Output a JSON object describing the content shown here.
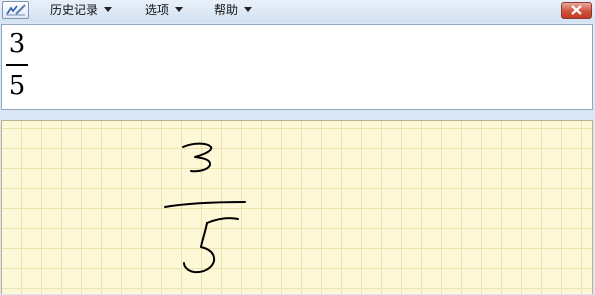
{
  "menu": {
    "history": "历史记录",
    "options": "选项",
    "help": "帮助"
  },
  "icons": {
    "app": "math-input-panel-icon",
    "close": "close-icon",
    "dropdown": "chevron-down-icon"
  },
  "result": {
    "numerator": "3",
    "denominator": "5"
  },
  "colors": {
    "titlebar": "#d3e2f2",
    "close": "#c43a25",
    "writing_pad": "#fdf8d8",
    "grid": "#efe3ad",
    "ink": "#000000"
  }
}
